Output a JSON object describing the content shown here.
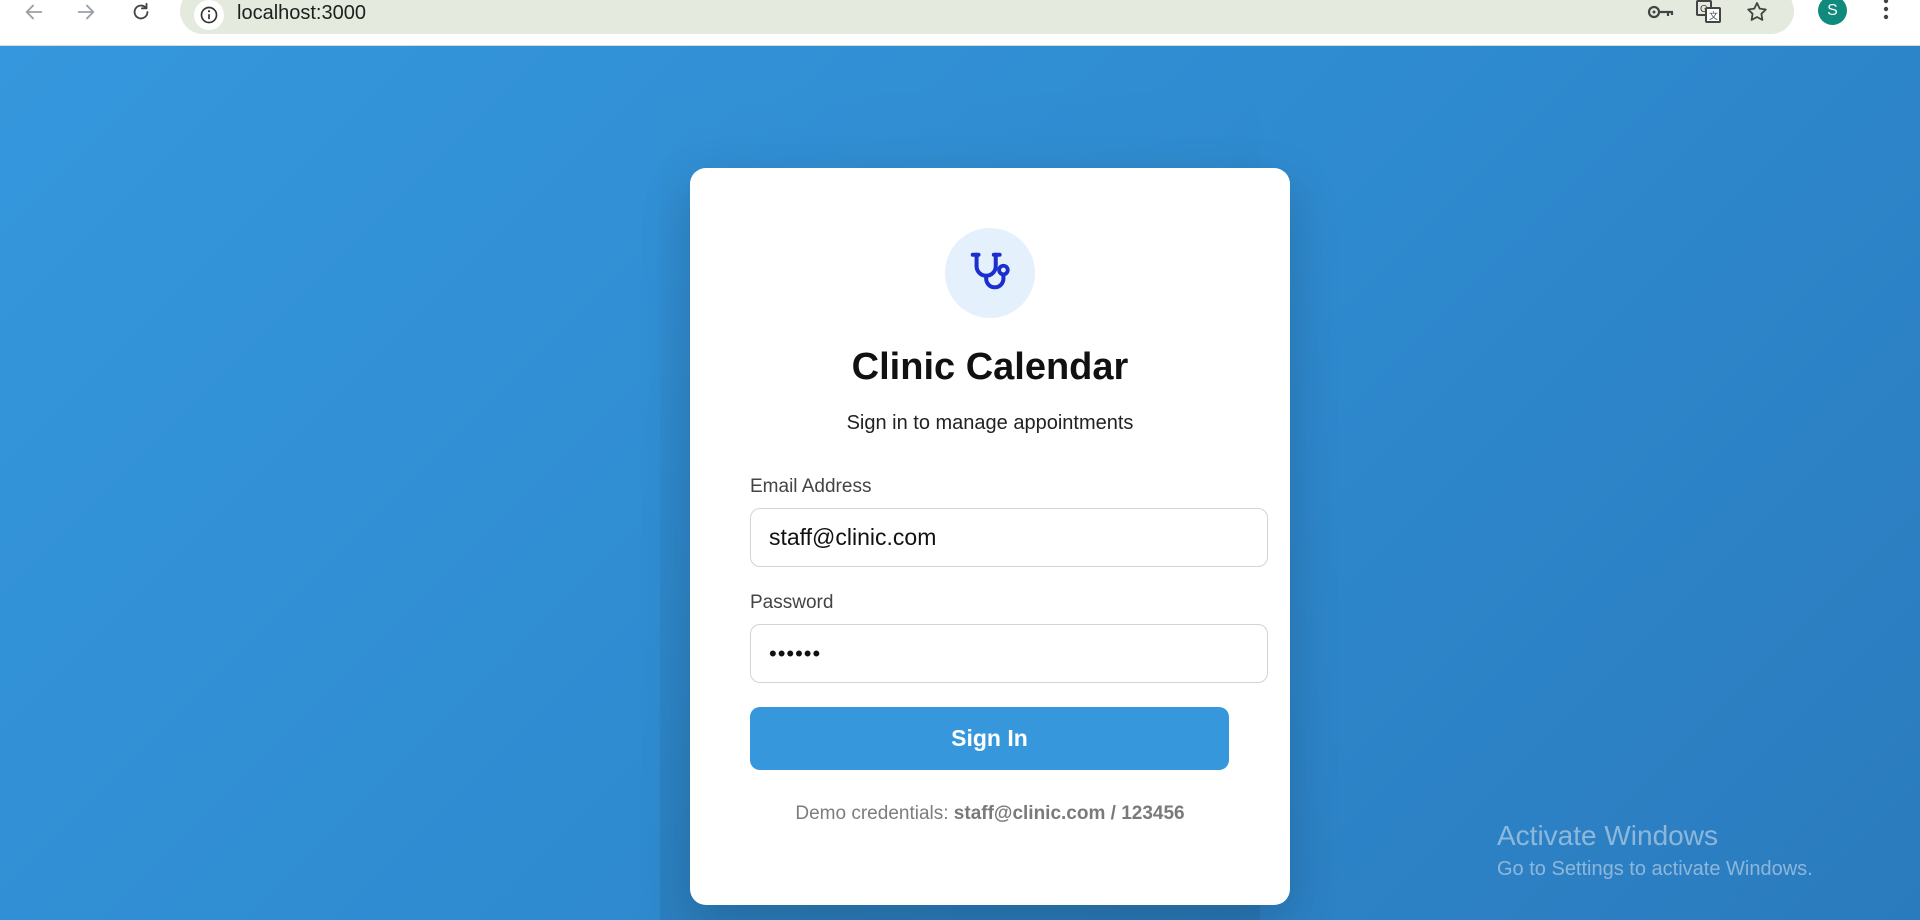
{
  "browser": {
    "url": "localhost:3000",
    "profile_initial": "S",
    "icons": [
      "back-icon",
      "forward-icon",
      "reload-icon",
      "site-info-icon",
      "password-key-icon",
      "translate-icon",
      "bookmark-star-icon",
      "menu-kebab-icon"
    ]
  },
  "login": {
    "logo_icon": "stethoscope-icon",
    "title": "Clinic Calendar",
    "subtitle": "Sign in to manage appointments",
    "email_label": "Email Address",
    "email_value": "staff@clinic.com",
    "password_label": "Password",
    "password_value": "••••••",
    "signin_label": "Sign In",
    "demo_prefix": "Demo credentials:",
    "demo_credentials": "staff@clinic.com / 123456"
  },
  "watermark": {
    "line1": "Activate Windows",
    "line2": "Go to Settings to activate Windows."
  },
  "colors": {
    "page_bg": "#3597dd",
    "primary": "#3697dc",
    "logo_bg": "#e4f0fb",
    "logo_icon": "#1b2fd0",
    "avatar": "#0f8a7c"
  }
}
